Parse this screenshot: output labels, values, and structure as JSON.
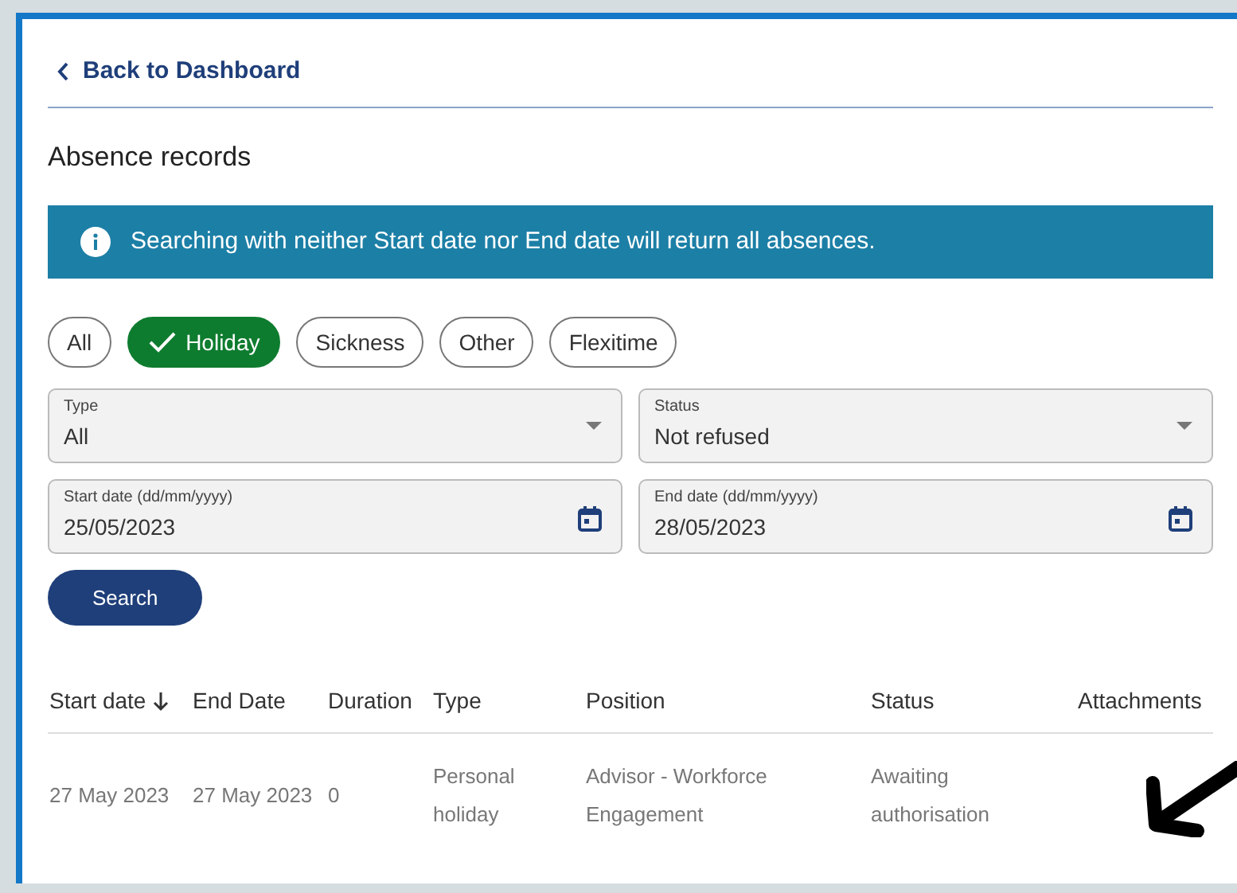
{
  "back_link": {
    "label": "Back to Dashboard"
  },
  "title": "Absence records",
  "info_banner": "Searching with neither Start date nor End date will return all absences.",
  "filter_chips": [
    {
      "label": "All",
      "selected": false
    },
    {
      "label": "Holiday",
      "selected": true
    },
    {
      "label": "Sickness",
      "selected": false
    },
    {
      "label": "Other",
      "selected": false
    },
    {
      "label": "Flexitime",
      "selected": false
    }
  ],
  "fields": [
    {
      "kind": "select",
      "label": "Type",
      "value": "All"
    },
    {
      "kind": "select",
      "label": "Status",
      "value": "Not refused"
    },
    {
      "kind": "date",
      "label": "Start date (dd/mm/yyyy)",
      "value": "25/05/2023"
    },
    {
      "kind": "date",
      "label": "End date (dd/mm/yyyy)",
      "value": "28/05/2023"
    }
  ],
  "search_button": "Search",
  "table": {
    "columns": [
      {
        "label": "Start date",
        "sorted": true
      },
      {
        "label": "End Date",
        "sorted": false
      },
      {
        "label": "Duration",
        "sorted": false
      },
      {
        "label": "Type",
        "sorted": false
      },
      {
        "label": "Position",
        "sorted": false
      },
      {
        "label": "Status",
        "sorted": false
      },
      {
        "label": "Attachments",
        "sorted": false
      }
    ],
    "rows": [
      {
        "cells": [
          "27 May 2023",
          "27 May 2023",
          "0",
          "Personal holiday",
          "Advisor - Workforce Engagement",
          "Awaiting authorisation",
          ""
        ]
      }
    ]
  }
}
